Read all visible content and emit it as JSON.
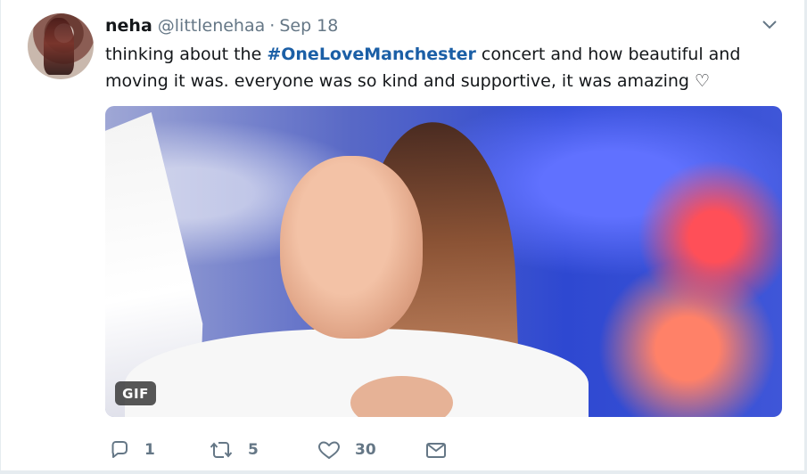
{
  "tweet": {
    "author_name": "neha",
    "handle": "@littlenehaa",
    "separator": "·",
    "date": "Sep 18",
    "text": {
      "before_hashtag": "thinking about the ",
      "hashtag": "#OneLoveManchester",
      "after_hashtag": " concert and how beautiful and moving it was. everyone was so kind and supportive, it was amazing ♡"
    },
    "media": {
      "badge": "GIF"
    },
    "actions": {
      "reply_count": "1",
      "retweet_count": "5",
      "like_count": "30"
    },
    "icons": {
      "menu": "chevron-down-icon",
      "reply": "reply-icon",
      "retweet": "retweet-icon",
      "like": "heart-icon",
      "message": "mail-icon"
    },
    "colors": {
      "link": "#1b5fa6",
      "secondary": "#657786",
      "background": "#ffffff"
    }
  }
}
